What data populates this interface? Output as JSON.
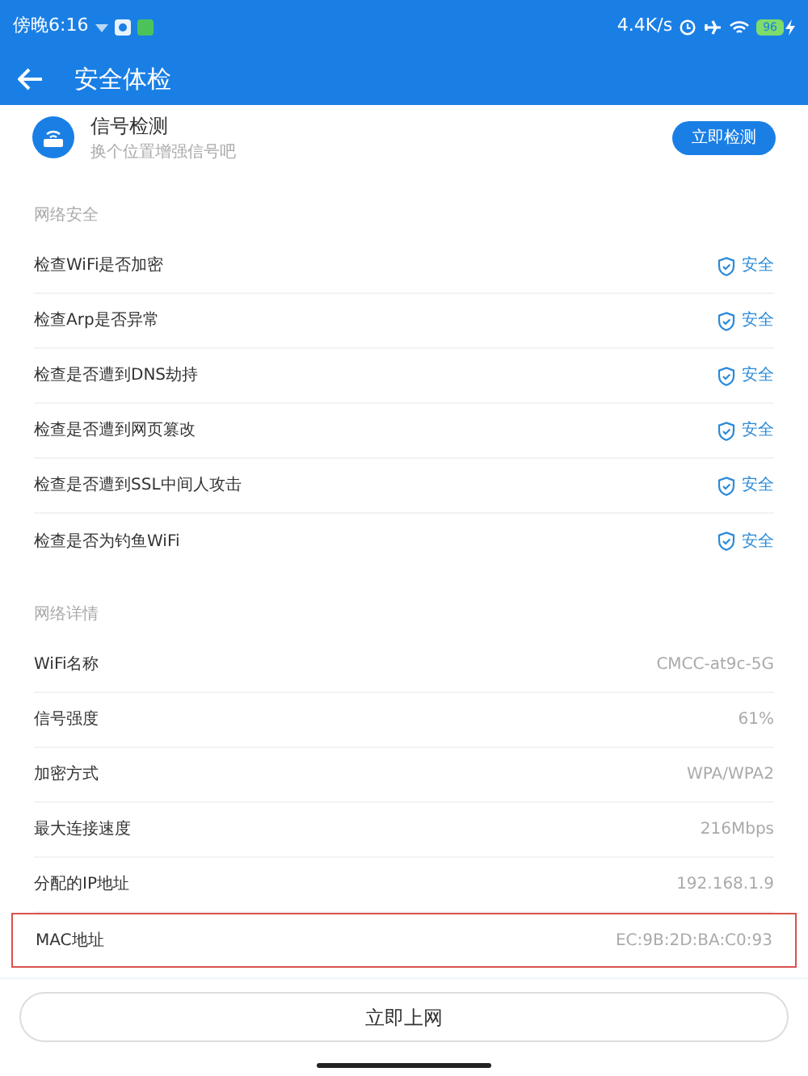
{
  "status_bar": {
    "time": "傍晚6:16",
    "speed": "4.4K/s",
    "battery": "96"
  },
  "header": {
    "title": "安全体检"
  },
  "signal_card": {
    "title": "信号检测",
    "subtitle": "换个位置增强信号吧",
    "button": "立即检测"
  },
  "security": {
    "heading": "网络安全",
    "rows": [
      {
        "label": "检查WiFi是否加密",
        "result": "安全"
      },
      {
        "label": "检查Arp是否异常",
        "result": "安全"
      },
      {
        "label": "检查是否遭到DNS劫持",
        "result": "安全"
      },
      {
        "label": "检查是否遭到网页篡改",
        "result": "安全"
      },
      {
        "label": "检查是否遭到SSL中间人攻击",
        "result": "安全"
      },
      {
        "label": "检查是否为钓鱼WiFi",
        "result": "安全"
      }
    ]
  },
  "details": {
    "heading": "网络详情",
    "rows": [
      {
        "label": "WiFi名称",
        "value": "CMCC-at9c-5G",
        "highlighted": false
      },
      {
        "label": "信号强度",
        "value": "61%",
        "highlighted": false
      },
      {
        "label": "加密方式",
        "value": "WPA/WPA2",
        "highlighted": false
      },
      {
        "label": "最大连接速度",
        "value": "216Mbps",
        "highlighted": false
      },
      {
        "label": "分配的IP地址",
        "value": "192.168.1.9",
        "highlighted": false
      },
      {
        "label": "MAC地址",
        "value": "EC:9B:2D:BA:C0:93",
        "highlighted": true
      }
    ]
  },
  "connect_button": "立即上网"
}
